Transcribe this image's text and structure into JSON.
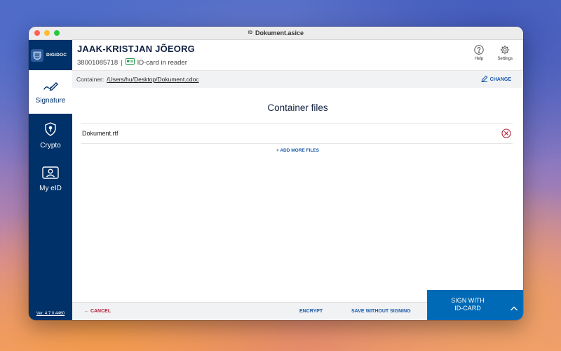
{
  "window": {
    "title": "Dokument.asice",
    "title_badge": "ID"
  },
  "sidebar": {
    "brand": "DIGIDOC",
    "items": [
      {
        "label": "Signature",
        "icon": "signature-pen-icon",
        "active": true
      },
      {
        "label": "Crypto",
        "icon": "shield-lock-icon",
        "active": false
      },
      {
        "label": "My eID",
        "icon": "id-card-person-icon",
        "active": false
      }
    ],
    "version": "Ver. 4.7.0.4460"
  },
  "header": {
    "user_name": "JAAK-KRISTJAN JÕEORG",
    "personal_code": "38001085718",
    "separator": "|",
    "card_status": "ID-card in reader",
    "help_label": "Help",
    "settings_label": "Settings"
  },
  "container": {
    "label": "Container:",
    "path": "/Users/hu/Desktop/Dokument.cdoc",
    "change_label": "CHANGE"
  },
  "files": {
    "title": "Container files",
    "items": [
      {
        "name": "Dokument.rtf"
      }
    ],
    "add_more_label": "+ ADD MORE FILES"
  },
  "footer": {
    "cancel_label": "← CANCEL",
    "encrypt_label": "ENCRYPT",
    "save_label": "SAVE WITHOUT SIGNING",
    "sign_label_line1": "SIGN WITH",
    "sign_label_line2": "ID-CARD"
  },
  "colors": {
    "sidebar_bg": "#003168",
    "primary": "#006ab6",
    "link": "#1a5aa8",
    "danger": "#b0203a"
  }
}
